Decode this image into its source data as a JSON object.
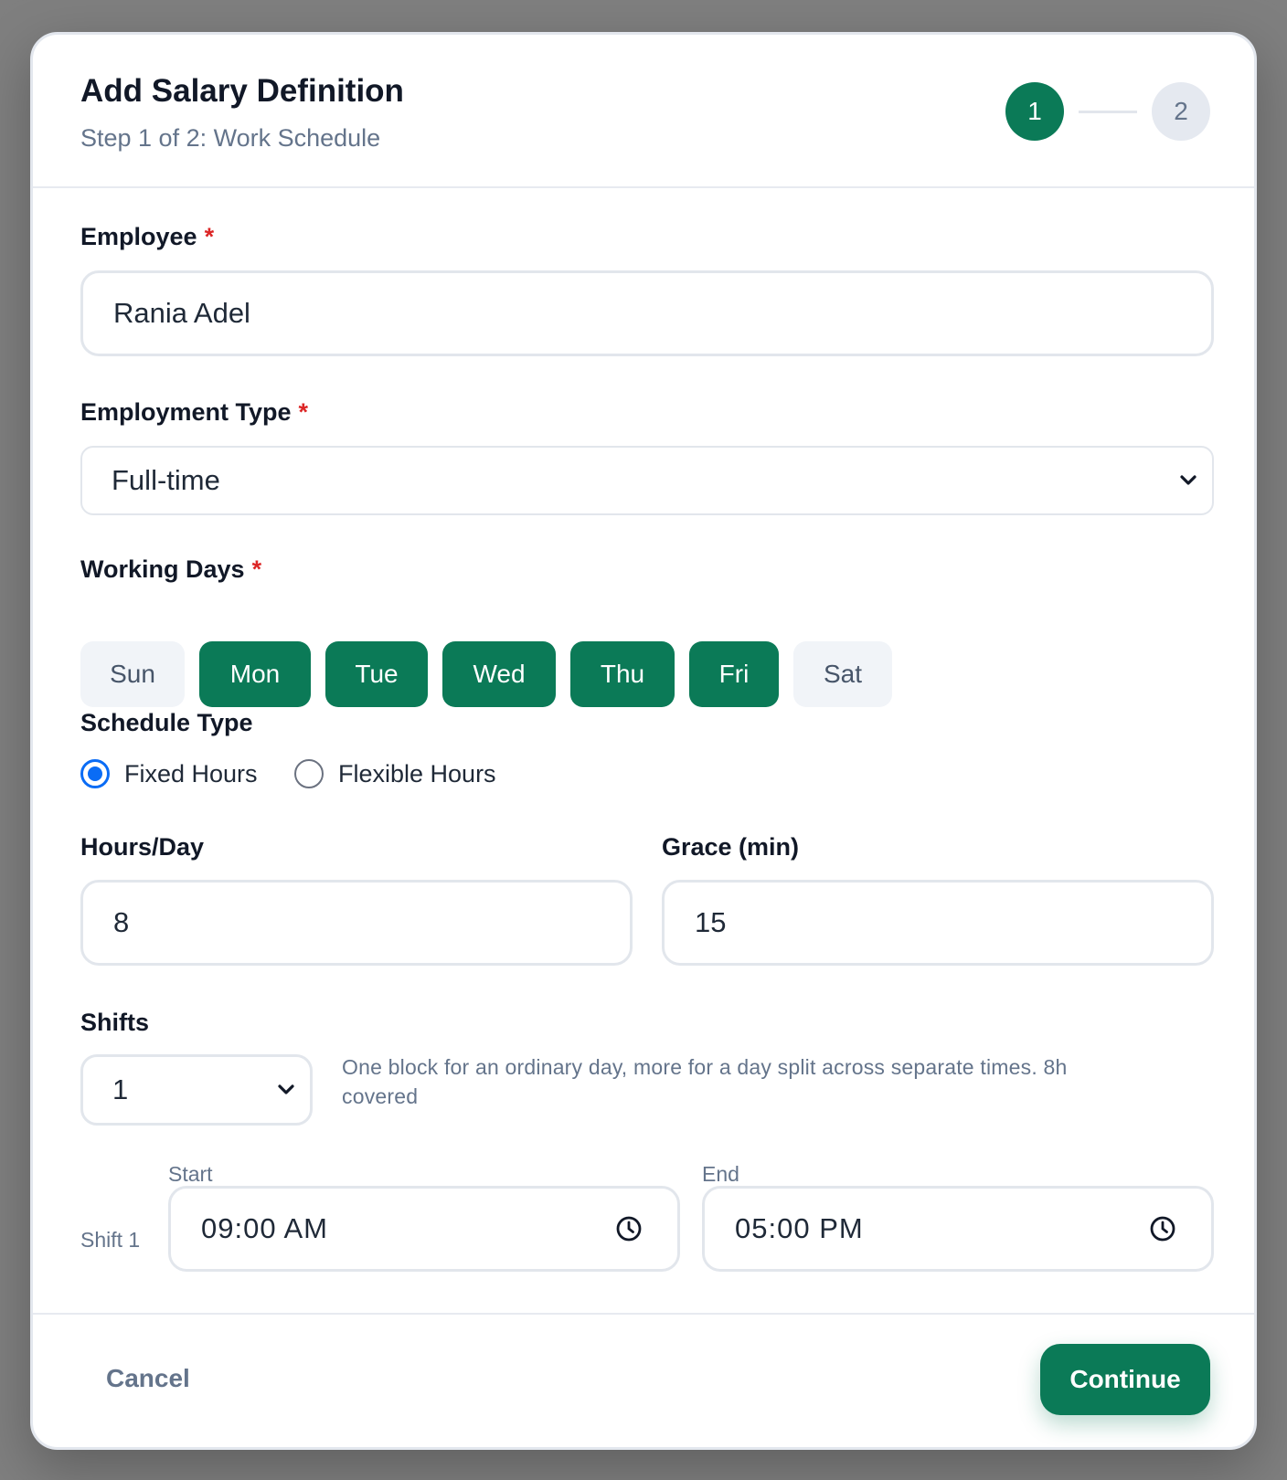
{
  "modal": {
    "title": "Add Salary Definition",
    "subtitle": "Step 1 of 2: Work Schedule",
    "steps": [
      "1",
      "2"
    ],
    "current_step": 1
  },
  "employee": {
    "label": "Employee",
    "required_mark": "*",
    "value": "Rania Adel"
  },
  "employment_type": {
    "label": "Employment Type",
    "required_mark": "*",
    "value": "Full-time"
  },
  "working_days": {
    "label": "Working Days",
    "required_mark": "*",
    "days": [
      {
        "label": "Sun",
        "selected": false
      },
      {
        "label": "Mon",
        "selected": true
      },
      {
        "label": "Tue",
        "selected": true
      },
      {
        "label": "Wed",
        "selected": true
      },
      {
        "label": "Thu",
        "selected": true
      },
      {
        "label": "Fri",
        "selected": true
      },
      {
        "label": "Sat",
        "selected": false
      }
    ]
  },
  "schedule_type": {
    "label": "Schedule Type",
    "options": [
      "Fixed Hours",
      "Flexible Hours"
    ],
    "selected": "Fixed Hours"
  },
  "hours_per_day": {
    "label": "Hours/Day",
    "value": "8"
  },
  "grace": {
    "label": "Grace (min)",
    "value": "15"
  },
  "shifts": {
    "label": "Shifts",
    "count": "1",
    "hint": "One block for an ordinary day, more for a day split across separate times. 8h covered",
    "items": [
      {
        "name": "Shift 1",
        "start_label": "Start",
        "start": "09:00 AM",
        "end_label": "End",
        "end": "05:00 PM"
      }
    ]
  },
  "footer": {
    "cancel_label": "Cancel",
    "continue_label": "Continue"
  },
  "colors": {
    "accent": "#0b7a57",
    "radio": "#0a6cf5",
    "required": "#dc2626"
  }
}
